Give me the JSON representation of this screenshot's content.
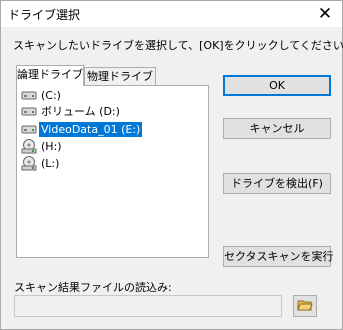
{
  "window": {
    "title": "ドライブ選択",
    "close_icon": "close-icon"
  },
  "instruction": "スキャンしたいドライブを選択して、[OK]をクリックしてください。",
  "tabs": [
    {
      "label": "論理ドライブ",
      "active": true
    },
    {
      "label": "物理ドライブ",
      "active": false
    }
  ],
  "drives": [
    {
      "label": "(C:)",
      "icon": "hard-drive-icon",
      "selected": false
    },
    {
      "label": "ボリューム (D:)",
      "icon": "hard-drive-icon",
      "selected": false
    },
    {
      "label": "VideoData_01 (E:)",
      "icon": "hard-drive-icon",
      "selected": true
    },
    {
      "label": "(H:)",
      "icon": "optical-drive-icon",
      "selected": false
    },
    {
      "label": "(L:)",
      "icon": "optical-drive-icon",
      "selected": false
    }
  ],
  "buttons": {
    "ok": "OK",
    "cancel": "キャンセル",
    "detect": "ドライブを検出(F)",
    "sector_scan": "セクタスキャンを実行"
  },
  "scan_result": {
    "label": "スキャン結果ファイルの読込み:",
    "value": "",
    "browse_icon": "open-folder-icon"
  },
  "colors": {
    "selection": "#0078d7",
    "default_button_border": "#0078d7"
  }
}
